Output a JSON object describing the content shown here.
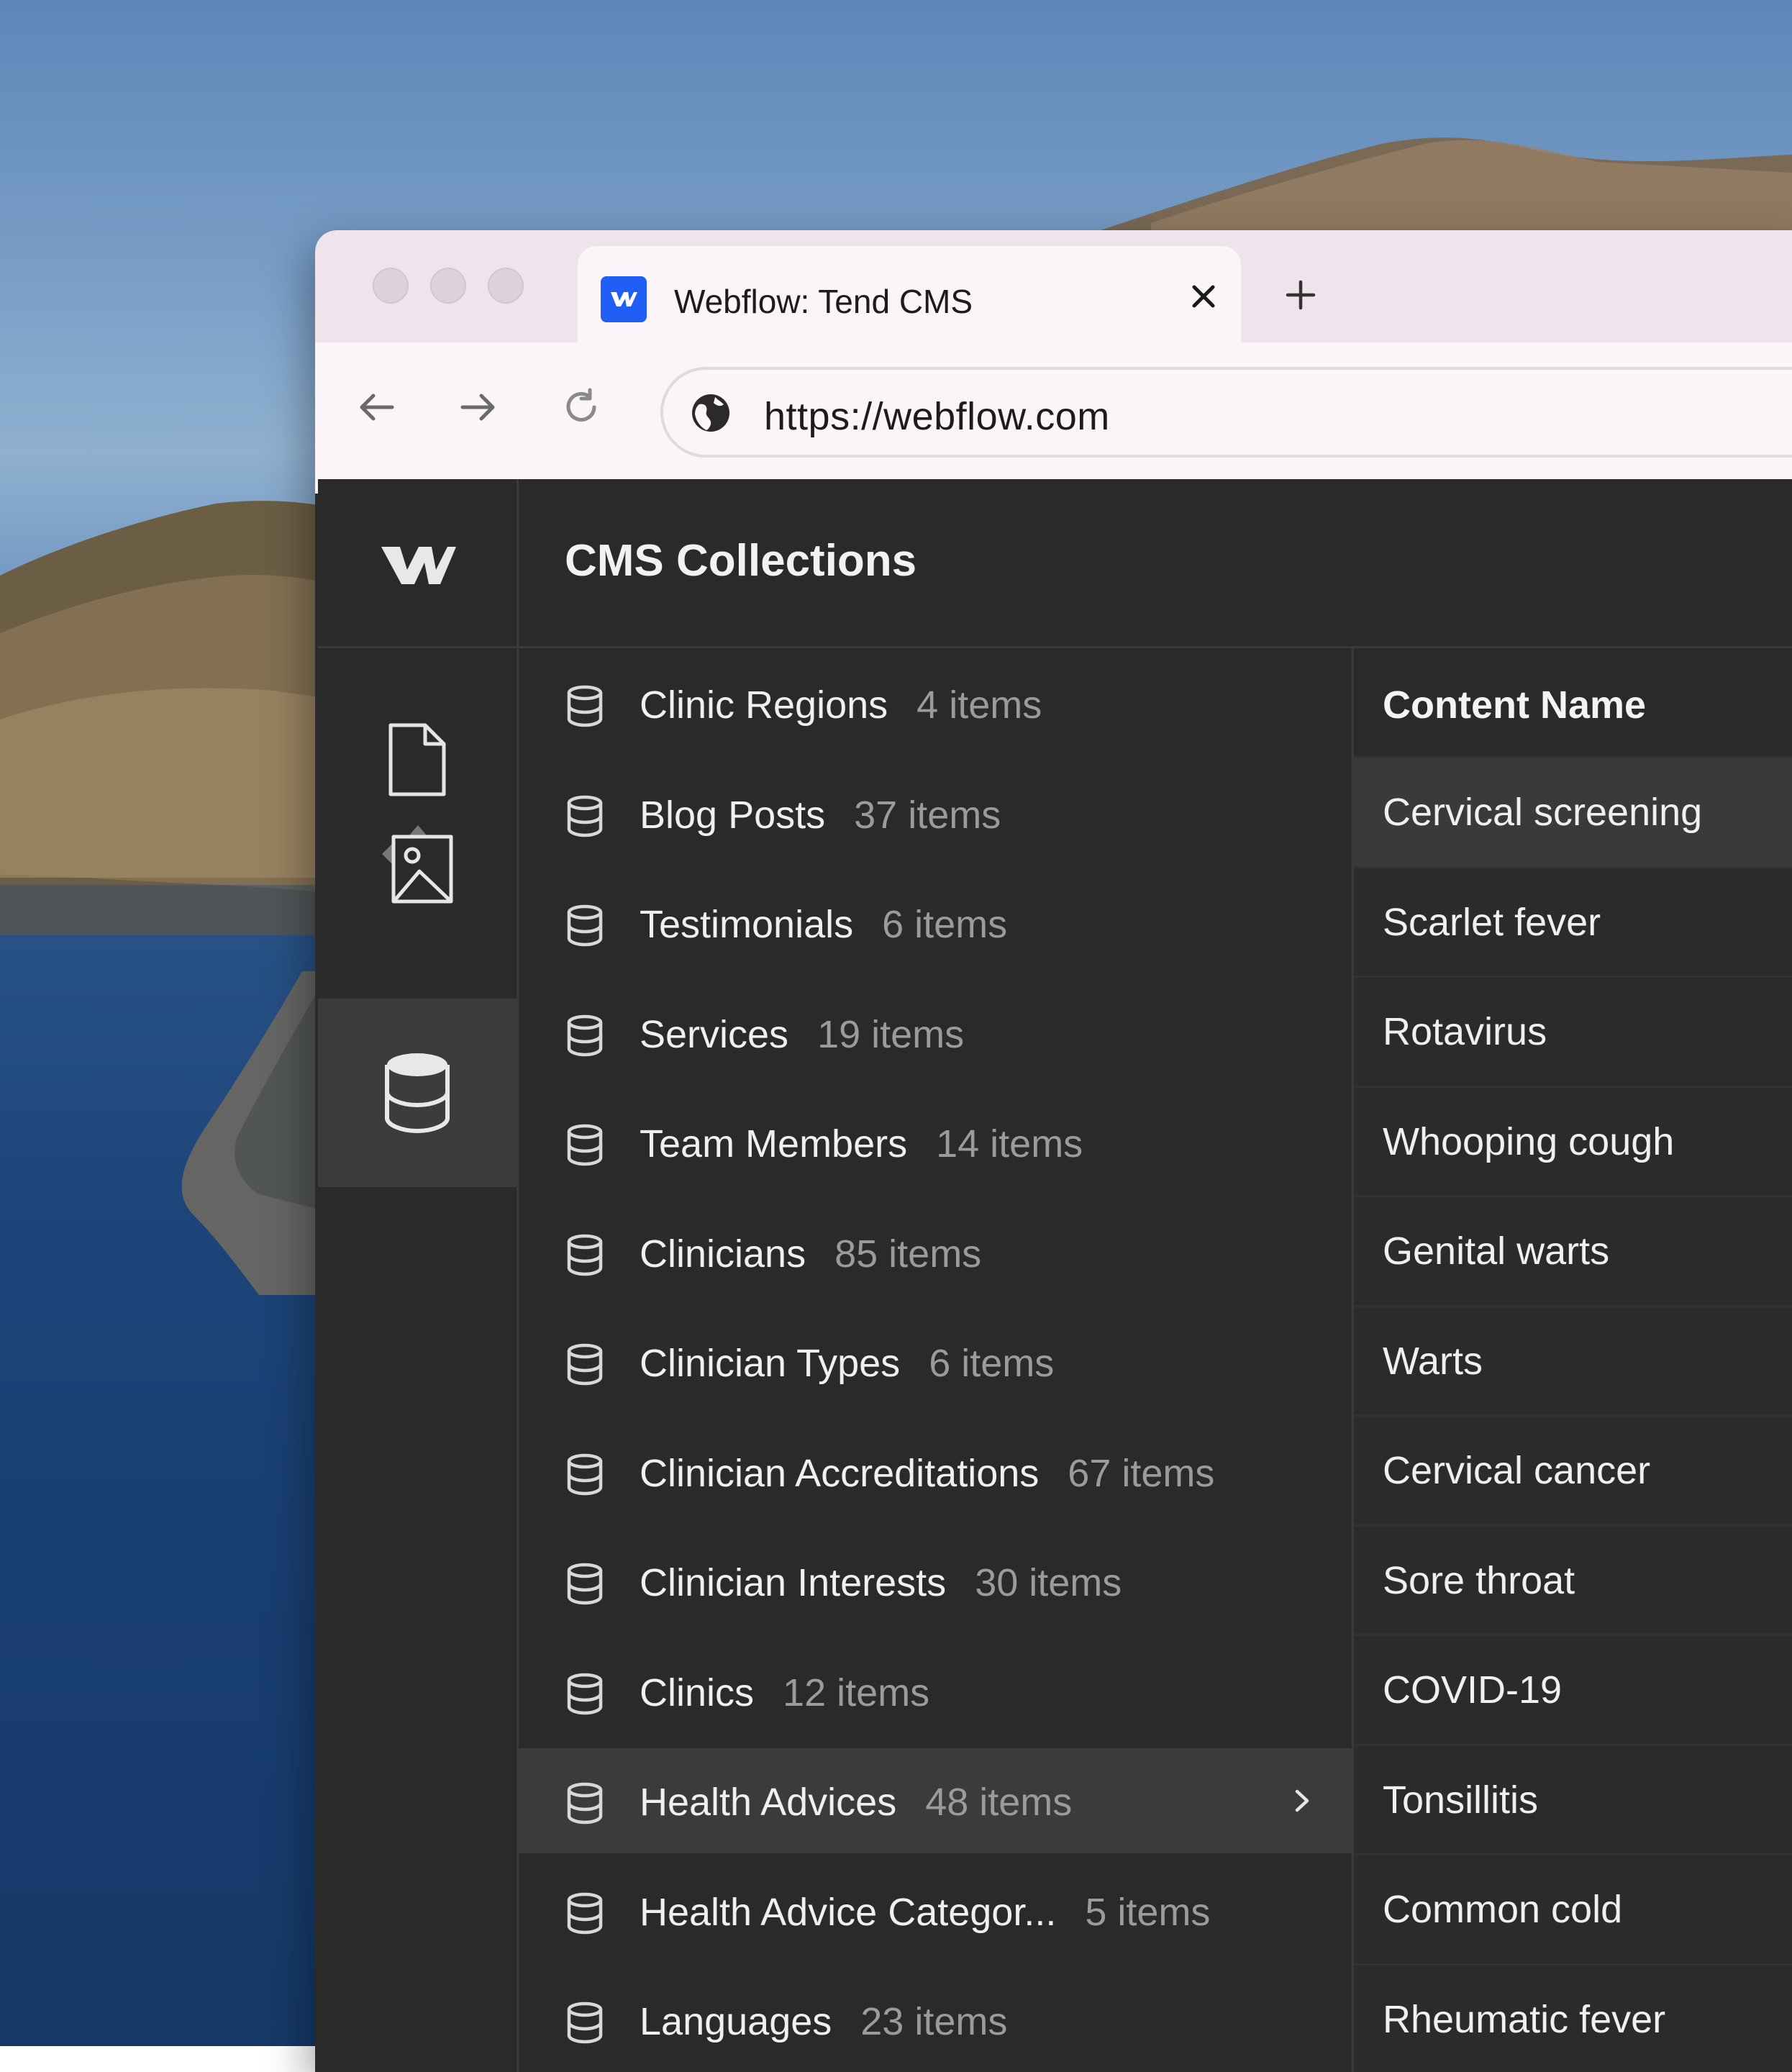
{
  "browser": {
    "tab_title": "Webflow: Tend CMS",
    "url": "https://webflow.com"
  },
  "icons": {
    "tab_logo": "webflow-logo-icon",
    "tab_close": "close-icon",
    "new_tab": "plus-icon",
    "back": "arrow-left-icon",
    "forward": "arrow-right-icon",
    "reload": "reload-icon",
    "site_info": "globe-icon",
    "rail_pages": "page-icon",
    "rail_assets": "image-icon",
    "rail_cms": "database-icon",
    "collection": "database-icon",
    "open_collection": "chevron-right-icon"
  },
  "app": {
    "header_title": "CMS Collections"
  },
  "collections": [
    {
      "name": "Clinic Regions",
      "count": "4 items"
    },
    {
      "name": "Blog Posts",
      "count": "37 items"
    },
    {
      "name": "Testimonials",
      "count": "6 items"
    },
    {
      "name": "Services",
      "count": "19 items"
    },
    {
      "name": "Team Members",
      "count": "14 items"
    },
    {
      "name": "Clinicians",
      "count": "85 items"
    },
    {
      "name": "Clinician Types",
      "count": "6 items"
    },
    {
      "name": "Clinician Accreditations",
      "count": "67 items"
    },
    {
      "name": "Clinician Interests",
      "count": "30 items"
    },
    {
      "name": "Clinics",
      "count": "12 items"
    },
    {
      "name": "Health Advices",
      "count": "48 items"
    },
    {
      "name": "Health Advice Categor...",
      "count": "5 items"
    },
    {
      "name": "Languages",
      "count": "23 items"
    }
  ],
  "content": {
    "column_header": "Content Name",
    "items": [
      "Cervical screening",
      "Scarlet fever",
      "Rotavirus",
      "Whooping cough",
      "Genital warts",
      "Warts",
      "Cervical cancer",
      "Sore throat",
      "COVID-19",
      "Tonsillitis",
      "Common cold",
      "Rheumatic fever"
    ]
  },
  "colors": {
    "tab_logo": "#1f5ff5",
    "tabbar": "#efe3ec",
    "toolbar": "#fbf4f9",
    "app_bg": "#2a2a2a",
    "selected_row": "#3b3b3b"
  }
}
